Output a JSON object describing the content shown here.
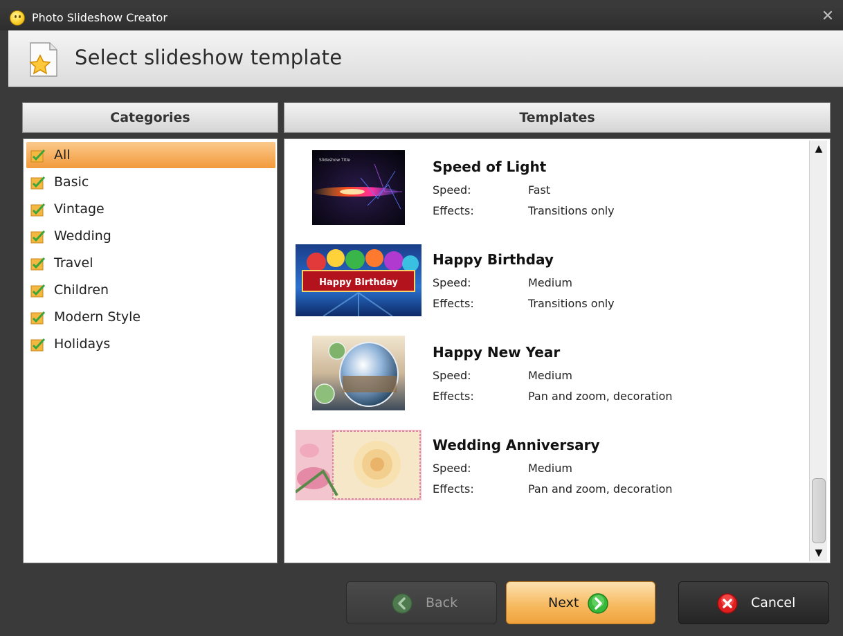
{
  "window": {
    "title": "Photo Slideshow Creator",
    "close_glyph": "✕",
    "icon": "app-smiley-icon"
  },
  "header": {
    "title": "Select slideshow template",
    "icon": "star-document-icon"
  },
  "categories": {
    "heading": "Categories",
    "selected_index": 0,
    "items": [
      {
        "label": "All"
      },
      {
        "label": "Basic"
      },
      {
        "label": "Vintage"
      },
      {
        "label": "Wedding"
      },
      {
        "label": "Travel"
      },
      {
        "label": "Children"
      },
      {
        "label": "Modern Style"
      },
      {
        "label": "Holidays"
      }
    ]
  },
  "templates": {
    "heading": "Templates",
    "items": [
      {
        "name": "Speed of Light",
        "speed_label": "Speed:",
        "speed": "Fast",
        "effects_label": "Effects:",
        "effects": "Transitions only",
        "thumbnail": "speed-of-light-thumbnail",
        "thumb_text": "Slideshow Title"
      },
      {
        "name": "Happy Birthday",
        "speed_label": "Speed:",
        "speed": "Medium",
        "effects_label": "Effects:",
        "effects": "Transitions only",
        "thumbnail": "happy-birthday-thumbnail",
        "thumb_text": "Happy Birthday"
      },
      {
        "name": "Happy New Year",
        "speed_label": "Speed:",
        "speed": "Medium",
        "effects_label": "Effects:",
        "effects": "Pan and zoom, decoration",
        "thumbnail": "happy-new-year-thumbnail"
      },
      {
        "name": "Wedding Anniversary",
        "speed_label": "Speed:",
        "speed": "Medium",
        "effects_label": "Effects:",
        "effects": "Pan and zoom, decoration",
        "thumbnail": "wedding-anniversary-thumbnail"
      }
    ],
    "scroll_position": 1.0
  },
  "buttons": {
    "back": {
      "label": "Back",
      "enabled": false
    },
    "next": {
      "label": "Next",
      "enabled": true
    },
    "cancel": {
      "label": "Cancel",
      "enabled": true
    }
  },
  "colors": {
    "selection": "#f29a3a",
    "next_button": "#f6b85c",
    "cancel_icon": "#e02020",
    "next_icon": "#3cb83c"
  }
}
